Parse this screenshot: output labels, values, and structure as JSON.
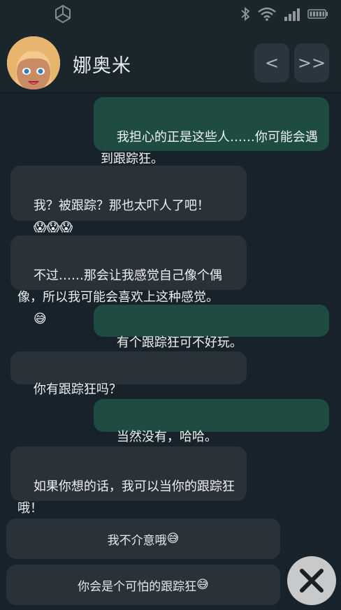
{
  "status_bar": {
    "icons": [
      "app-hexagon-icon",
      "bluetooth-icon",
      "wifi-icon",
      "signal-icon",
      "battery-icon"
    ]
  },
  "header": {
    "name": "娜奥米",
    "prev_label": "<",
    "next_label": ">>"
  },
  "messages": [
    {
      "from": "me",
      "text": "我担心的正是这些人……你可能会遇到跟踪狂。"
    },
    {
      "from": "her",
      "text": "我？被跟踪？那也太吓人了吧！",
      "emoji": "😱😱😱"
    },
    {
      "from": "her",
      "text": "不过……那会让我感觉自己像个偶像，所以我可能会喜欢上这种感觉。",
      "emoji": "😅"
    },
    {
      "from": "me",
      "text": "有个跟踪狂可不好玩。"
    },
    {
      "from": "her",
      "text": "你有跟踪狂吗？"
    },
    {
      "from": "me",
      "text": "当然没有，哈哈。"
    },
    {
      "from": "her",
      "text": "如果你想的话，我可以当你的跟踪狂哦！",
      "emoji": "😘"
    }
  ],
  "replies": [
    {
      "text": "我不介意哦",
      "emoji": "😅"
    },
    {
      "text": "你会是个可怕的跟踪狂",
      "emoji": "😅"
    }
  ],
  "colors": {
    "background": "#17222a",
    "my_bubble": "#1f4c42",
    "her_bubble": "#2a3239",
    "close_button": "#c8c9ca"
  }
}
